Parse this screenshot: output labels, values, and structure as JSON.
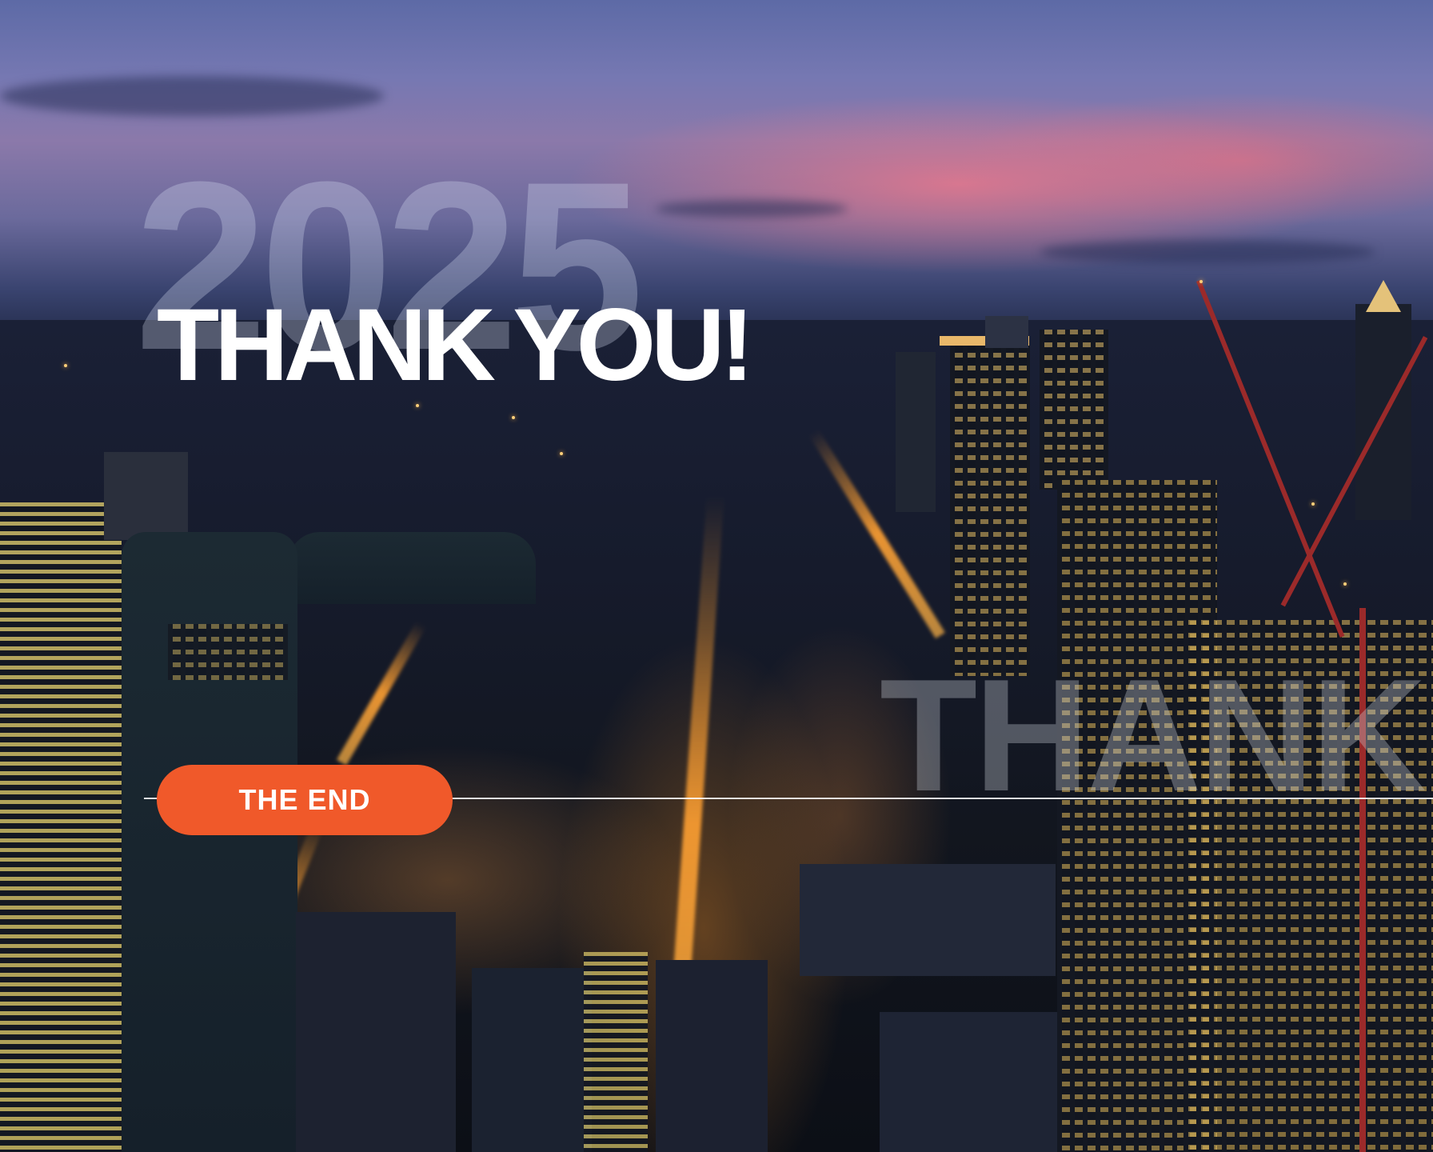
{
  "slide": {
    "year": "2025",
    "headline": "THANK YOU!",
    "watermark_text": "THANK",
    "end_label": "THE END"
  },
  "colors": {
    "accent": "#f0592a",
    "headline": "#ffffff"
  }
}
